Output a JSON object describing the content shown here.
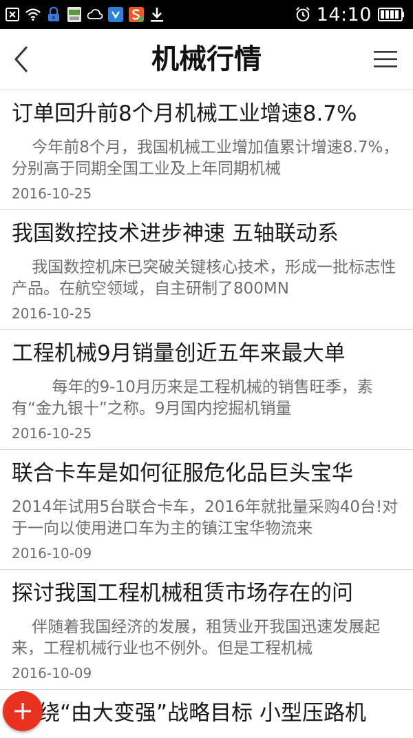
{
  "status_bar": {
    "time": "14:10",
    "icons": [
      "close-box-icon",
      "wifi-icon",
      "lock-icon",
      "sim-card-icon",
      "cloud-icon",
      "app-store-icon",
      "sogou-icon",
      "download-icon",
      "alarm-icon",
      "battery-icon"
    ]
  },
  "header": {
    "title": "机械行情",
    "back_icon": "back-arrow-icon",
    "menu_icon": "menu-icon"
  },
  "articles": [
    {
      "title": "订单回升前8个月机械工业增速8.7%",
      "summary": "    今年前8个月，我国机械工业增加值累计增速8.7%，分别高于同期全国工业及上年同期机械",
      "date": "2016-10-25"
    },
    {
      "title": "我国数控技术进步神速 五轴联动系",
      "summary": "    我国数控机床已突破关键核心技术，形成一批标志性产品。在航空领域，自主研制了800MN",
      "date": "2016-10-25"
    },
    {
      "title": "工程机械9月销量创近五年来最大单",
      "summary": "        每年的9-10月历来是工程机械的销售旺季，素有“金九银十”之称。9月国内挖掘机销量",
      "date": "2016-10-25"
    },
    {
      "title": "联合卡车是如何征服危化品巨头宝华",
      "summary": "2014年试用5台联合卡车，2016年就批量采购40台!对于一向以使用进口车为主的镇江宝华物流来",
      "date": "2016-10-09"
    },
    {
      "title": "探讨我国工程机械租赁市场存在的问",
      "summary": "    伴随着我国经济的发展，租赁业开我国迅速发展起来，工程机械行业也不例外。但是工程机械",
      "date": "2016-10-09"
    },
    {
      "title": "绕“由大变强”战略目标 小型压路机",
      "summary": "",
      "date": ""
    }
  ],
  "fab": {
    "icon": "plus-icon",
    "color": "#e8321f"
  }
}
